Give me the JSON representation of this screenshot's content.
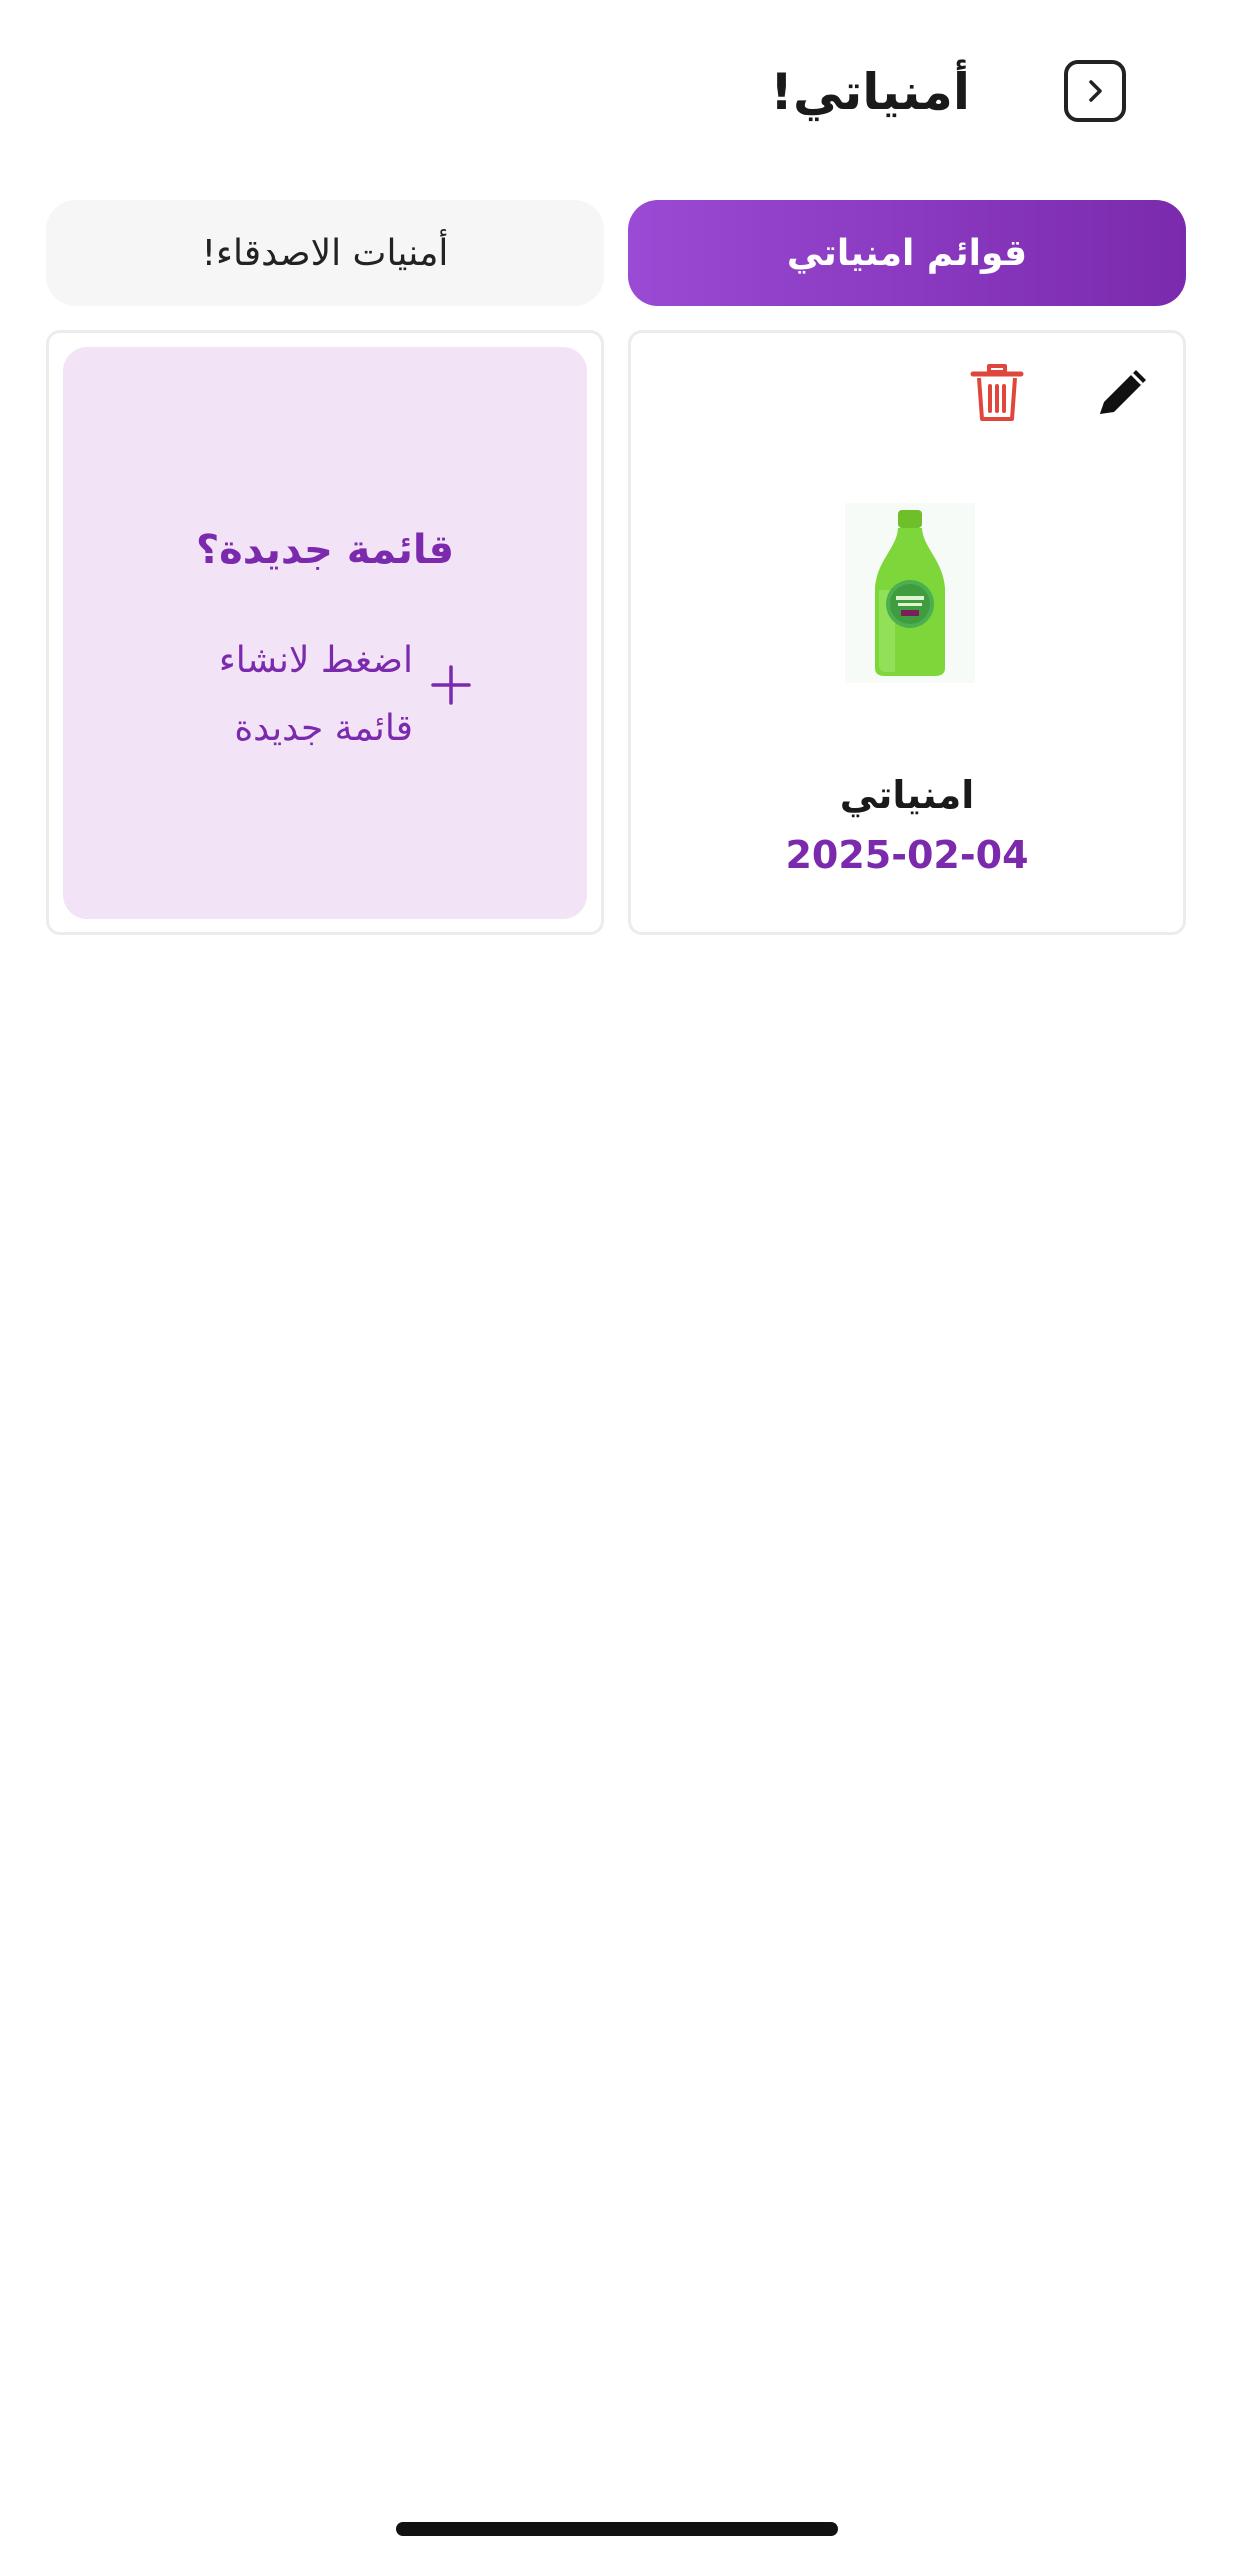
{
  "header": {
    "title": "أمنياتي!",
    "back_icon": "chevron-right-icon"
  },
  "tabs": [
    {
      "label": "قوائم امنياتي",
      "active": true
    },
    {
      "label": "أمنيات الاصدقاء!",
      "active": false
    }
  ],
  "wishlists": [
    {
      "name": "امنياتي",
      "date": "2025-02-04",
      "image": "green-lotion-bottle",
      "edit_icon": "pencil-icon",
      "delete_icon": "trash-icon"
    }
  ],
  "new_list_card": {
    "title": "قائمة جديدة؟",
    "hint_line1": "اضغط لانشاء",
    "hint_line2": "قائمة جديدة",
    "icon": "plus-icon"
  },
  "colors": {
    "accent": "#7b2aad",
    "accent_light": "#9a4ad4",
    "card_tint": "#f2e3f6",
    "delete": "#e0473c",
    "tab_inactive_bg": "#f6f6f6"
  }
}
